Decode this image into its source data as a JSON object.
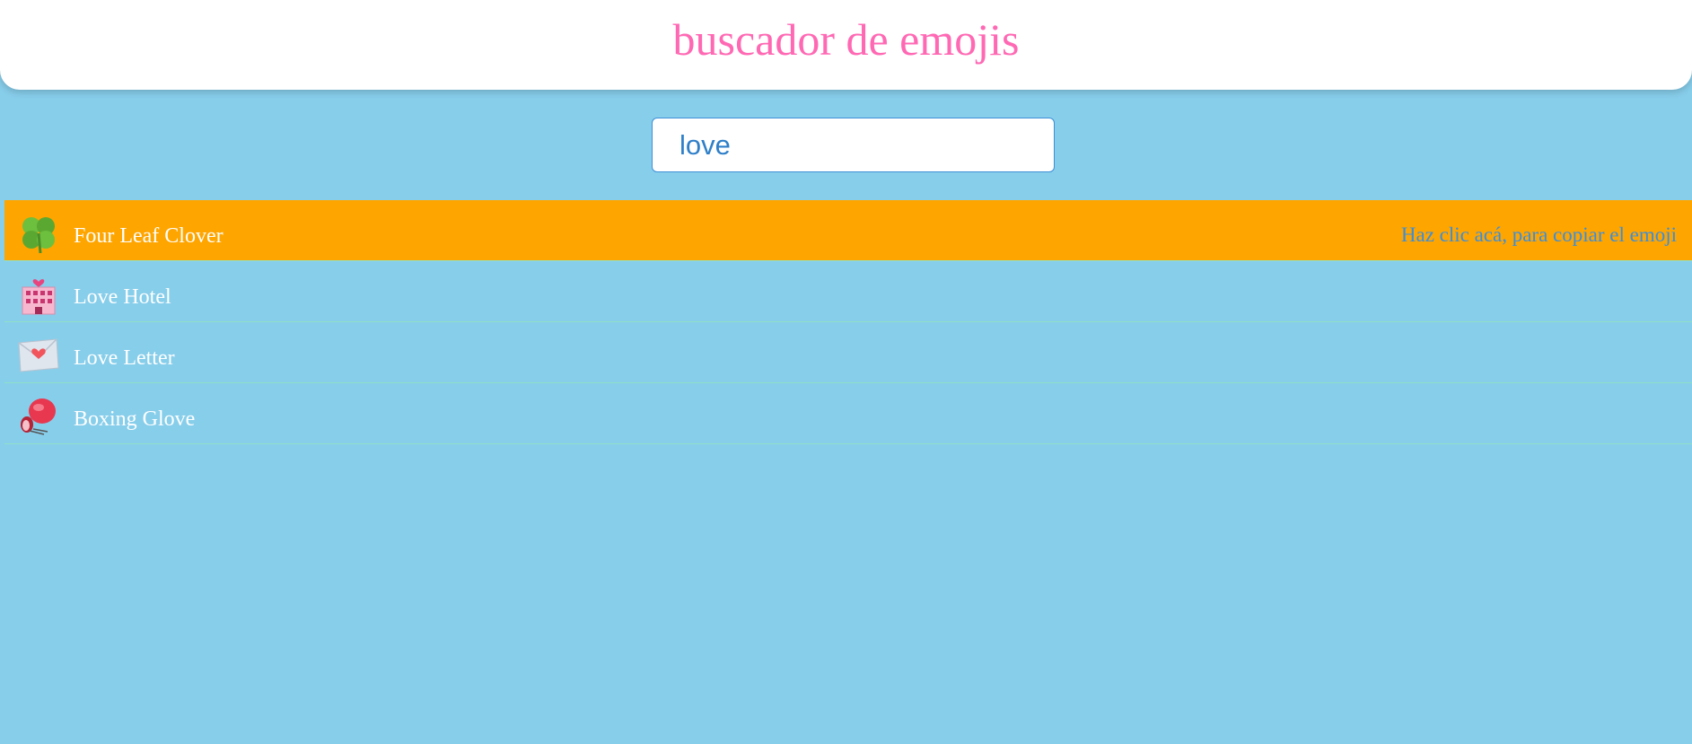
{
  "header": {
    "title": "buscador de emojis"
  },
  "search": {
    "value": "love"
  },
  "results": {
    "copy_hint": "Haz clic acá, para copiar el emoji",
    "items": [
      {
        "label": "Four Leaf Clover",
        "icon": "four-leaf-clover-icon",
        "highlighted": true
      },
      {
        "label": "Love Hotel",
        "icon": "love-hotel-icon",
        "highlighted": false
      },
      {
        "label": "Love Letter",
        "icon": "love-letter-icon",
        "highlighted": false
      },
      {
        "label": "Boxing Glove",
        "icon": "boxing-glove-icon",
        "highlighted": false
      }
    ]
  },
  "colors": {
    "background": "#87CEEB",
    "title": "#ff69b4",
    "highlight": "#FFA500",
    "hint": "#3b8edb",
    "row_text": "#ffffff"
  }
}
